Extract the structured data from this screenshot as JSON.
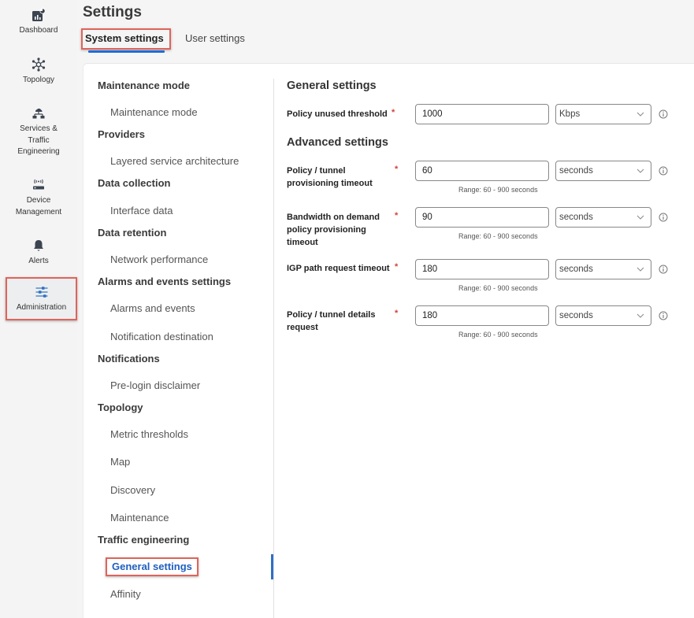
{
  "leftnav": {
    "items": [
      {
        "label": "Dashboard",
        "icon": "dashboard-icon"
      },
      {
        "label": "Topology",
        "icon": "topology-icon"
      },
      {
        "label": "Services & Traffic Engineering",
        "line1": "Services &",
        "line2": "Traffic",
        "line3": "Engineering",
        "icon": "services-icon"
      },
      {
        "label": "Device Management",
        "line1": "Device",
        "line2": "Management",
        "icon": "device-icon"
      },
      {
        "label": "Alerts",
        "icon": "bell-icon"
      },
      {
        "label": "Administration",
        "icon": "sliders-icon",
        "active": true
      }
    ]
  },
  "header": {
    "title": "Settings",
    "tabs": [
      {
        "label": "System settings",
        "active": true
      },
      {
        "label": "User settings",
        "active": false
      }
    ]
  },
  "tree": {
    "groups": [
      {
        "label": "Maintenance mode",
        "items": [
          "Maintenance mode"
        ]
      },
      {
        "label": "Providers",
        "items": [
          "Layered service architecture"
        ]
      },
      {
        "label": "Data collection",
        "items": [
          "Interface data"
        ]
      },
      {
        "label": "Data retention",
        "items": [
          "Network performance"
        ]
      },
      {
        "label": "Alarms and events settings",
        "items": [
          "Alarms and events",
          "Notification destination"
        ]
      },
      {
        "label": "Notifications",
        "items": [
          "Pre-login disclaimer"
        ]
      },
      {
        "label": "Topology",
        "items": [
          "Metric thresholds",
          "Map",
          "Discovery",
          "Maintenance"
        ]
      },
      {
        "label": "Traffic engineering",
        "items": [
          "General settings",
          "Affinity"
        ]
      }
    ],
    "selected": "General settings"
  },
  "form": {
    "general_title": "General settings",
    "advanced_title": "Advanced settings",
    "required_mark": "*",
    "fields": [
      {
        "label": "Policy unused threshold",
        "value": "1000",
        "unit": "Kbps",
        "hint": ""
      },
      {
        "label": "Policy / tunnel provisioning timeout",
        "value": "60",
        "unit": "seconds",
        "hint": "Range: 60 - 900 seconds"
      },
      {
        "label": "Bandwidth on demand policy provisioning timeout",
        "value": "90",
        "unit": "seconds",
        "hint": "Range: 60 - 900 seconds"
      },
      {
        "label": "IGP path request timeout",
        "value": "180",
        "unit": "seconds",
        "hint": "Range: 60 - 900 seconds"
      },
      {
        "label": "Policy / tunnel details request",
        "value": "180",
        "unit": "seconds",
        "hint": "Range: 60 - 900 seconds"
      }
    ]
  },
  "colors": {
    "accent": "#1f6bd6",
    "highlight_box": "#e0645a",
    "required": "#d0443a"
  }
}
